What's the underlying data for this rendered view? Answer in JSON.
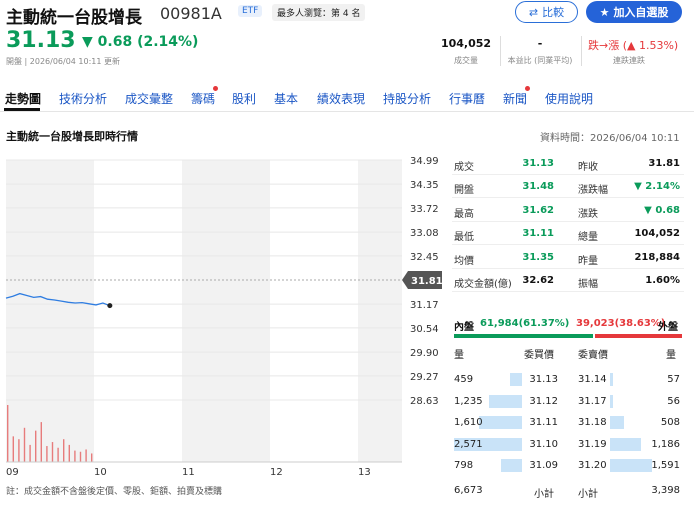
{
  "header": {
    "title": "主動統一台股增長",
    "code": "00981A",
    "etf_badge": "ETF",
    "rank_badge": "最多人瀏覽：第 4 名",
    "compare_label": "比較",
    "add_watchlist_label": "加入自選股",
    "price": "31.13",
    "change": "0.68 (2.14%)",
    "updated": "開盤 | 2026/06/04 10:11 更新",
    "volume_value": "104,052",
    "volume_label": "成交量",
    "pe_value": "-",
    "pe_label": "本益比 (同業平均)",
    "limit_value": "跌→漲 (▲ 1.53%)",
    "limit_label": "連跌連跌"
  },
  "tabs": [
    "走勢圖",
    "技術分析",
    "成交彙整",
    "籌碼",
    "股利",
    "基本",
    "績效表現",
    "持股分析",
    "行事曆",
    "新聞",
    "使用說明"
  ],
  "section": {
    "title": "主動統一台股增長即時行情",
    "data_time": "資料時間：2026/06/04 10:11"
  },
  "chart_data": {
    "type": "line",
    "y_ticks": [
      "34.99",
      "34.35",
      "33.72",
      "33.08",
      "32.45",
      "31.81",
      "31.17",
      "30.54",
      "29.90",
      "29.27",
      "28.63"
    ],
    "x_ticks": [
      "09",
      "10",
      "11",
      "12",
      "13"
    ],
    "ref_price": "31.81",
    "ylim": [
      28.63,
      34.99
    ],
    "x": [
      "09:00",
      "09:05",
      "09:10",
      "09:15",
      "09:20",
      "09:25",
      "09:30",
      "09:35",
      "09:40",
      "09:45",
      "09:50",
      "09:55",
      "10:00",
      "10:05",
      "10:10",
      "10:11"
    ],
    "values": [
      31.33,
      31.38,
      31.45,
      31.4,
      31.35,
      31.37,
      31.3,
      31.28,
      31.25,
      31.22,
      31.2,
      31.21,
      31.18,
      31.15,
      31.2,
      31.13
    ],
    "volumes": [
      100,
      45,
      40,
      60,
      30,
      55,
      70,
      28,
      35,
      25,
      40,
      30,
      20,
      18,
      22,
      15
    ]
  },
  "quote": {
    "left": [
      {
        "label": "成交",
        "value": "31.13",
        "color": "green"
      },
      {
        "label": "開盤",
        "value": "31.48",
        "color": "green"
      },
      {
        "label": "最高",
        "value": "31.62",
        "color": "green"
      },
      {
        "label": "最低",
        "value": "31.11",
        "color": "green"
      },
      {
        "label": "均價",
        "value": "31.35",
        "color": "green"
      },
      {
        "label": "成交金額(億)",
        "value": "32.62",
        "color": "dark"
      }
    ],
    "right": [
      {
        "label": "昨收",
        "value": "31.81",
        "color": "dark"
      },
      {
        "label": "漲跌幅",
        "value": "▼ 2.14%",
        "color": "green"
      },
      {
        "label": "漲跌",
        "value": "▼ 0.68",
        "color": "green"
      },
      {
        "label": "總量",
        "value": "104,052",
        "color": "dark"
      },
      {
        "label": "昨量",
        "value": "218,884",
        "color": "dark"
      },
      {
        "label": "振幅",
        "value": "1.60%",
        "color": "dark"
      }
    ]
  },
  "inout": {
    "in_label": "內盤",
    "in_value": "61,984(61.37%)",
    "out_value": "39,023(38.63%)",
    "out_label": "外盤",
    "in_fraction": 0.6137
  },
  "orderbook": {
    "headers": [
      "量",
      "委買價",
      "委賣價",
      "量"
    ],
    "bids": [
      {
        "qty": "459",
        "price": "31.13",
        "bar": 0.18
      },
      {
        "qty": "1,235",
        "price": "31.12",
        "bar": 0.48
      },
      {
        "qty": "1,610",
        "price": "31.11",
        "bar": 0.63
      },
      {
        "qty": "2,571",
        "price": "31.10",
        "bar": 1.0
      },
      {
        "qty": "798",
        "price": "31.09",
        "bar": 0.31
      }
    ],
    "asks": [
      {
        "price": "31.14",
        "qty": "57",
        "bar": 0.04
      },
      {
        "price": "31.17",
        "qty": "56",
        "bar": 0.04
      },
      {
        "price": "31.18",
        "qty": "508",
        "bar": 0.2
      },
      {
        "price": "31.19",
        "qty": "1,186",
        "bar": 0.46
      },
      {
        "price": "31.20",
        "qty": "1,591",
        "bar": 0.62
      }
    ],
    "bid_total": "6,673",
    "bid_total_label": "小計",
    "ask_total_label": "小計",
    "ask_total": "3,398"
  },
  "footnote": "註：成交金額不含盤後定價、零股、鉅額、拍賣及標購"
}
